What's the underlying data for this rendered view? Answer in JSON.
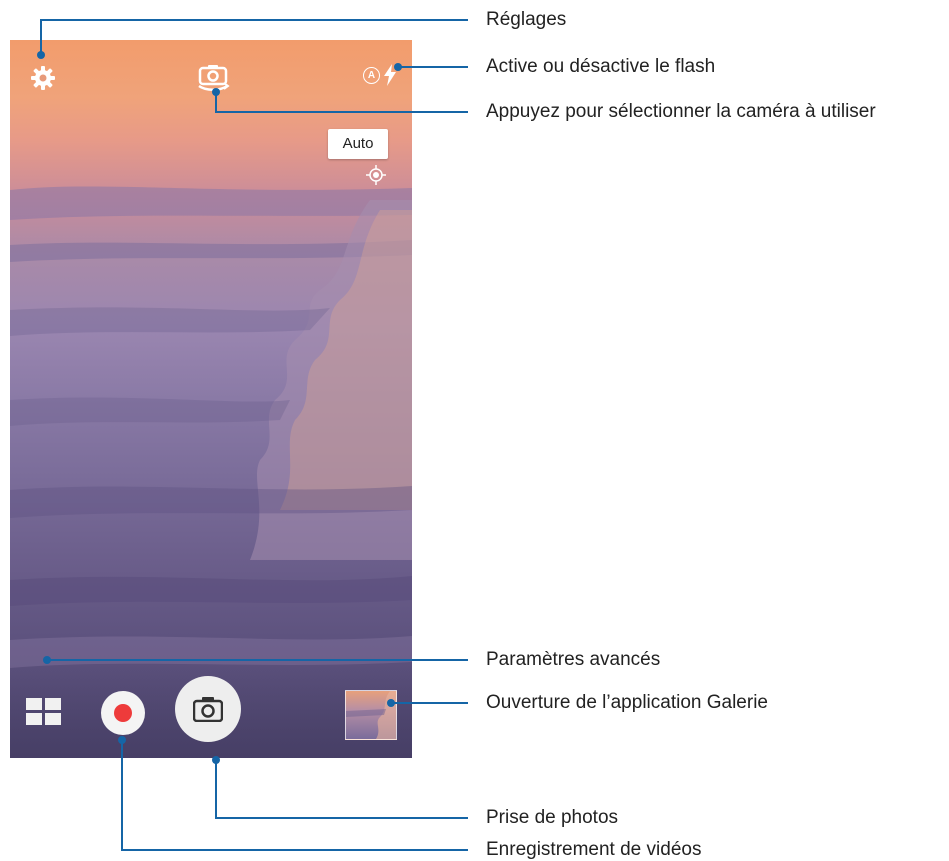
{
  "camera": {
    "mode_chip": "Auto",
    "icons": {
      "settings": "gear-icon",
      "switch_camera": "switch-camera-icon",
      "flash": "flash-auto-icon",
      "focus": "focus-target-icon",
      "advanced": "grid-icon",
      "record": "record-icon",
      "shutter": "camera-icon",
      "gallery": "gallery-thumbnail"
    },
    "flash_badge": "A"
  },
  "callouts": {
    "settings": "Réglages",
    "flash": "Active ou désactive le flash",
    "switch_camera": "Appuyez pour sélectionner la caméra à utiliser",
    "advanced": "Paramètres avancés",
    "gallery": "Ouverture de l’application Galerie",
    "photo": "Prise de photos",
    "video": "Enregistrement de vidéos"
  },
  "colors": {
    "callout_line": "#1565a6",
    "record_red": "#ee3b3b"
  }
}
